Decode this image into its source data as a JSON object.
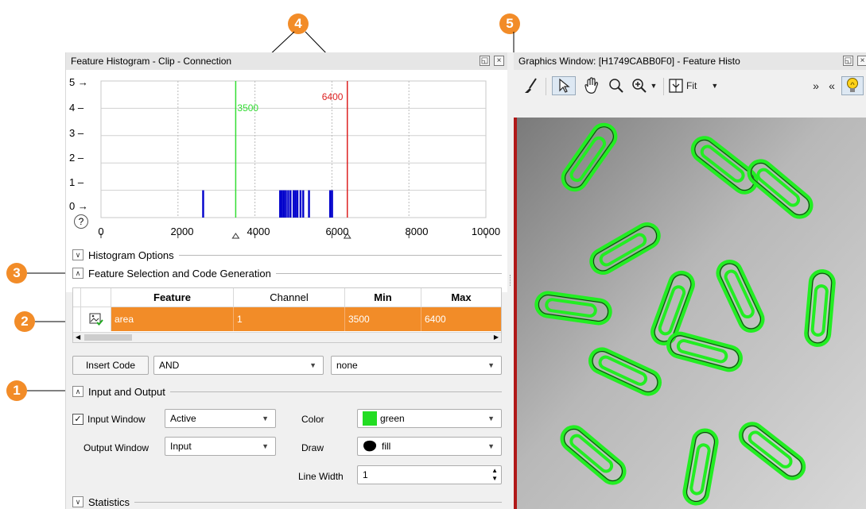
{
  "callouts": [
    "1",
    "2",
    "3",
    "4",
    "5"
  ],
  "histogram_window": {
    "title": "Feature Histogram - Clip - Connection",
    "float_icon": "restore-icon",
    "close_icon": "close-icon",
    "y_ticks": [
      "5",
      "4",
      "3",
      "2",
      "1",
      "0"
    ],
    "x_ticks": [
      "0",
      "2000",
      "4000",
      "6000",
      "8000",
      "10000"
    ],
    "help_glyph": "?",
    "lower_threshold": {
      "value": 3500,
      "label": "3500",
      "color": "#33dd33"
    },
    "upper_threshold": {
      "value": 6400,
      "label": "6400",
      "color": "#dd2222"
    },
    "x_range": [
      0,
      10000
    ],
    "y_range": [
      0,
      5
    ],
    "bars": [
      2650,
      4650,
      4700,
      4750,
      4800,
      4860,
      4920,
      5000,
      5050,
      5100,
      5180,
      5250,
      5400,
      5950,
      6000
    ],
    "bar_color": "#0000cc"
  },
  "sections": {
    "histogram_options": "Histogram Options",
    "feature_selection": "Feature Selection and Code Generation",
    "input_output": "Input and Output",
    "statistics": "Statistics"
  },
  "feature_table": {
    "columns": [
      "Feature",
      "Channel",
      "Min",
      "Max"
    ],
    "row": {
      "feature": "area",
      "channel": "1",
      "min": "3500",
      "max": "6400"
    },
    "row_color": "#f28c28"
  },
  "code_gen": {
    "insert_code": "Insert Code",
    "operator": "AND",
    "mode": "none"
  },
  "io": {
    "input_window_label": "Input Window",
    "input_window_checked": true,
    "input_window_value": "Active",
    "output_window_label": "Output Window",
    "output_window_value": "Input",
    "color_label": "Color",
    "color_value": "green",
    "color_swatch": "#22dd22",
    "draw_label": "Draw",
    "draw_value": "fill",
    "line_width_label": "Line Width",
    "line_width_value": "1"
  },
  "graphics_window": {
    "title": "Graphics Window: [H1749CABB0F0] - Feature Histo",
    "fit_label": "Fit",
    "tools": [
      "clear-brush-icon",
      "pointer-icon",
      "pan-hand-icon",
      "zoom-icon",
      "zoom-in-icon",
      "fit-icon",
      "expand-icon",
      "collapse-icon",
      "lightbulb-icon"
    ],
    "overflow_right": "»",
    "overflow_left": "«"
  }
}
